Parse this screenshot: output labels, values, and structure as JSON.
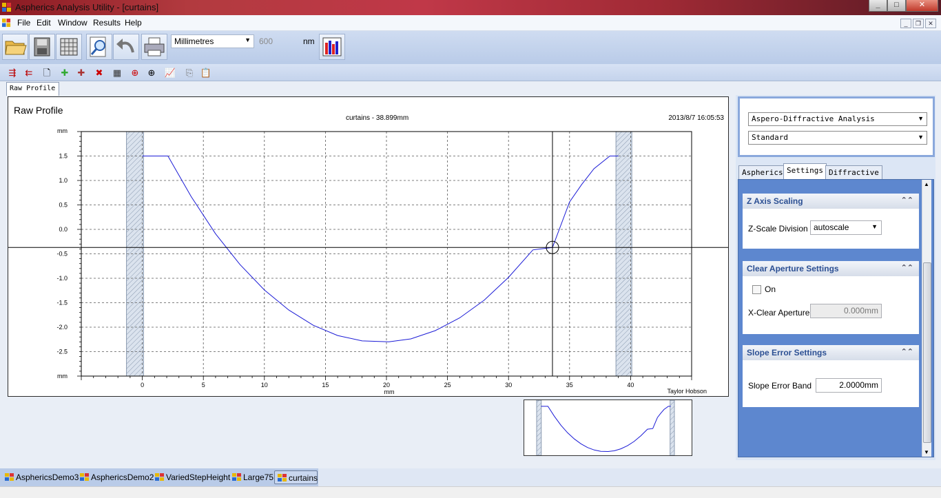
{
  "window": {
    "title": "Aspherics Analysis Utility - [curtains]",
    "controls": {
      "minimize": "_",
      "maximize": "□",
      "close": "✕"
    }
  },
  "menu": {
    "items": [
      "File",
      "Edit",
      "Window",
      "Results",
      "Help"
    ],
    "mdi_controls": {
      "minimize": "_",
      "restore": "❐",
      "close": "✕"
    }
  },
  "toolbar": {
    "units": "Millimetres",
    "wavelength_value": "600",
    "wavelength_unit": "nm",
    "big_icons": [
      "open-folder-icon",
      "save-icon",
      "grid-icon",
      "zoom-icon",
      "undo-icon",
      "print-icon",
      "bar-chart-icon"
    ],
    "small_icons": [
      "add-marker-icon",
      "remove-marker-icon",
      "new-page-icon",
      "fit-green-icon",
      "fit-red-icon",
      "delete-x-icon",
      "hatch-icon",
      "crosshair-red-icon",
      "crosshair-black-icon",
      "chart-icon",
      "copy-icon",
      "paste-icon"
    ]
  },
  "document_tab": "Raw Profile",
  "chart": {
    "title": "Raw Profile",
    "subtitle": "curtains - 38.899mm",
    "datetime": "2013/8/7 16:05:53",
    "credit": "Taylor Hobson"
  },
  "chart_data": {
    "type": "line",
    "xlabel": "mm",
    "ylabel": "mm",
    "xlim": [
      -5,
      45
    ],
    "ylim": [
      -3,
      2
    ],
    "x_ticks": [
      "0",
      "5",
      "10",
      "15",
      "20",
      "25",
      "30",
      "35",
      "40"
    ],
    "y_ticks": [
      "1.5",
      "1.0",
      "0.5",
      "0.0",
      "-0.5",
      "-1.0",
      "-1.5",
      "-2.0",
      "-2.5"
    ],
    "series": [
      {
        "x": [
          0,
          2.1,
          4,
          6,
          8,
          10,
          12,
          14,
          16,
          18,
          20.2,
          22,
          24,
          26,
          28,
          30,
          32,
          33.6,
          35,
          36,
          37,
          38.3,
          39
        ],
        "y": [
          1.5,
          1.5,
          0.67,
          -0.09,
          -0.72,
          -1.24,
          -1.65,
          -1.96,
          -2.17,
          -2.28,
          -2.3,
          -2.24,
          -2.07,
          -1.81,
          -1.45,
          -0.98,
          -0.42,
          -0.37,
          0.56,
          0.92,
          1.24,
          1.5,
          1.5
        ]
      }
    ],
    "excluded_bands": [
      [
        -1.3,
        0.1
      ],
      [
        38.8,
        40.1
      ]
    ],
    "cursor": {
      "x": 33.6,
      "y": -0.37
    },
    "grid": true
  },
  "right_panel": {
    "analysis_select": "Aspero-Diffractive Analysis",
    "mode_select": "Standard",
    "tabs": [
      "Aspherics",
      "Settings",
      "Diffractive"
    ],
    "z_axis": {
      "heading": "Z Axis Scaling",
      "label": "Z-Scale Division",
      "value": "autoscale"
    },
    "clear_aperture": {
      "heading": "Clear Aperture Settings",
      "checkbox_label": "On",
      "field_label": "X-Clear Aperture",
      "value": "0.000mm"
    },
    "slope_error": {
      "heading": "Slope Error Settings",
      "field_label": "Slope Error Band",
      "value": "2.0000mm"
    }
  },
  "bottom_tabs": [
    "AsphericsDemo3",
    "AsphericsDemo2",
    "VariedStepHeight",
    "Large75",
    "curtains"
  ],
  "colors": {
    "curve": "#1a1ad6",
    "grid": "#555555",
    "accent": "#5d87cf"
  }
}
